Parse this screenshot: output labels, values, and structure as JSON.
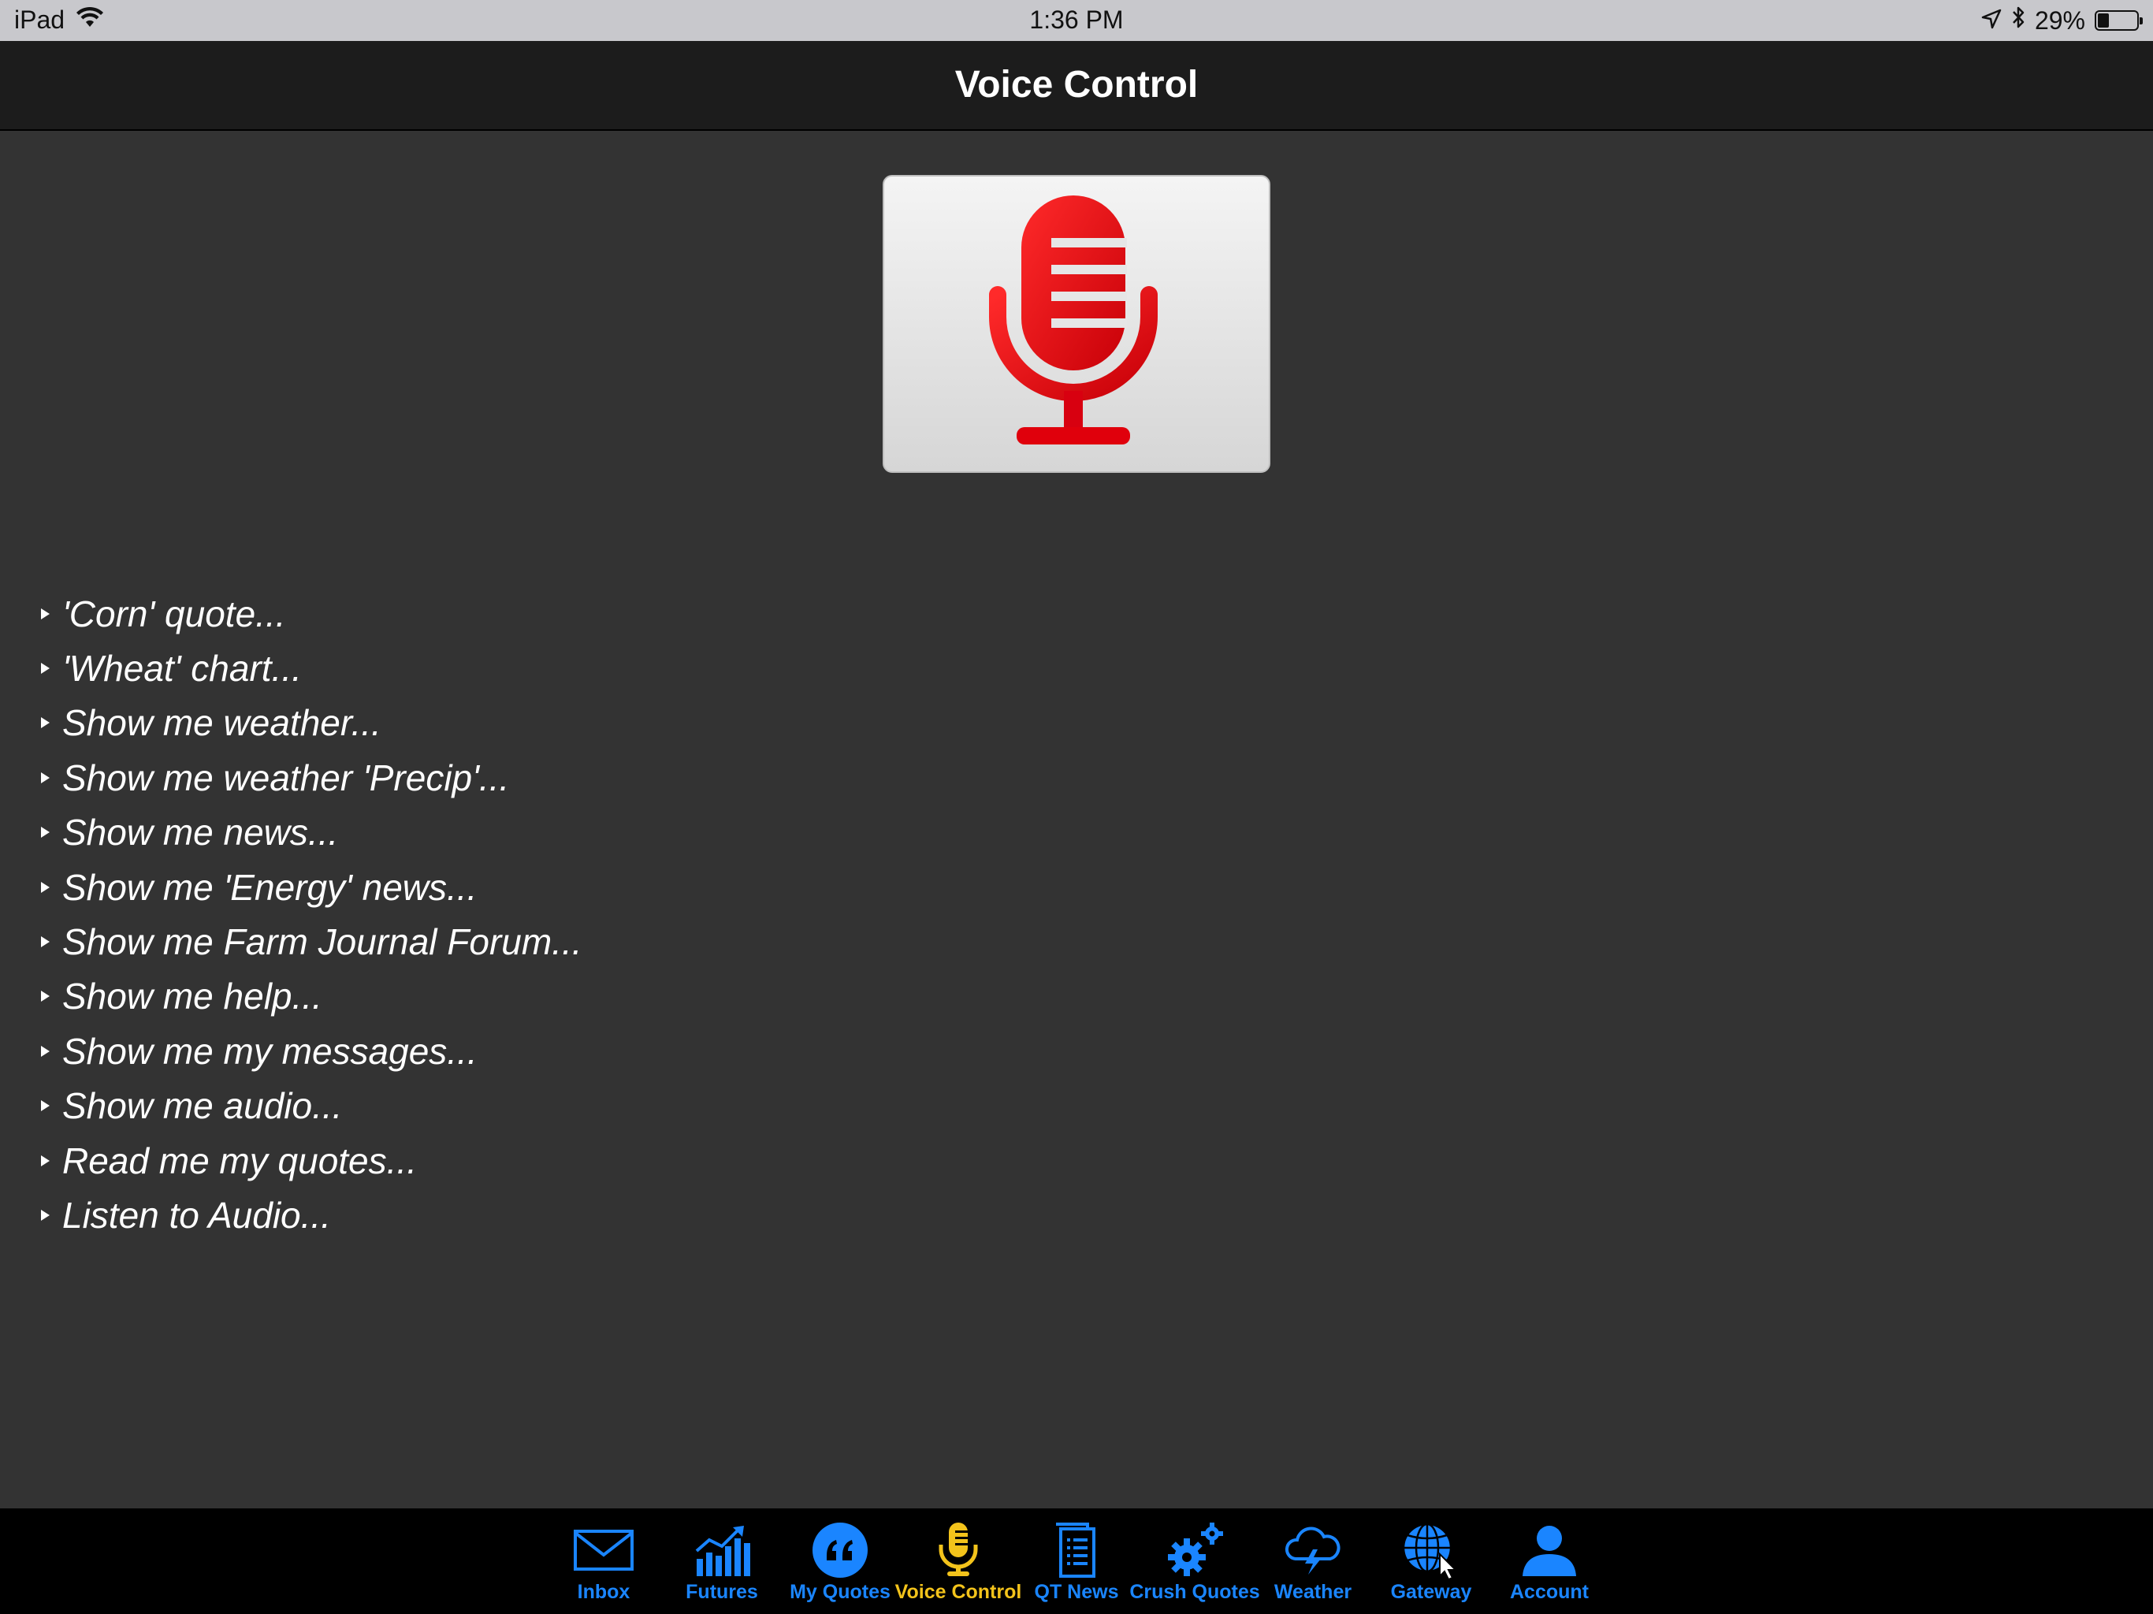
{
  "status_bar": {
    "device": "iPad",
    "time": "1:36 PM",
    "battery_percent": "29%",
    "battery_level": 0.29
  },
  "nav": {
    "title": "Voice Control"
  },
  "mic_button": {
    "icon": "microphone-icon",
    "color": "#e8000b"
  },
  "commands": [
    "'Corn' quote...",
    "'Wheat' chart...",
    "Show me weather...",
    "Show me weather 'Precip'...",
    "Show me news...",
    "Show me 'Energy' news...",
    "Show me Farm Journal Forum...",
    "Show me help...",
    "Show me my messages...",
    "Show me audio...",
    "Read me my quotes...",
    "Listen to Audio..."
  ],
  "tabs": [
    {
      "label": "Inbox",
      "icon": "envelope-icon"
    },
    {
      "label": "Futures",
      "icon": "bar-chart-icon"
    },
    {
      "label": "My Quotes",
      "icon": "quote-icon"
    },
    {
      "label": "Voice Control",
      "icon": "microphone-icon",
      "active": true
    },
    {
      "label": "QT News",
      "icon": "document-icon"
    },
    {
      "label": "Crush Quotes",
      "icon": "gears-icon"
    },
    {
      "label": "Weather",
      "icon": "storm-cloud-icon"
    },
    {
      "label": "Gateway",
      "icon": "globe-icon"
    },
    {
      "label": "Account",
      "icon": "person-icon"
    }
  ],
  "colors": {
    "tab_inactive": "#1a85ff",
    "tab_active": "#f3c31b",
    "background": "#333333"
  }
}
